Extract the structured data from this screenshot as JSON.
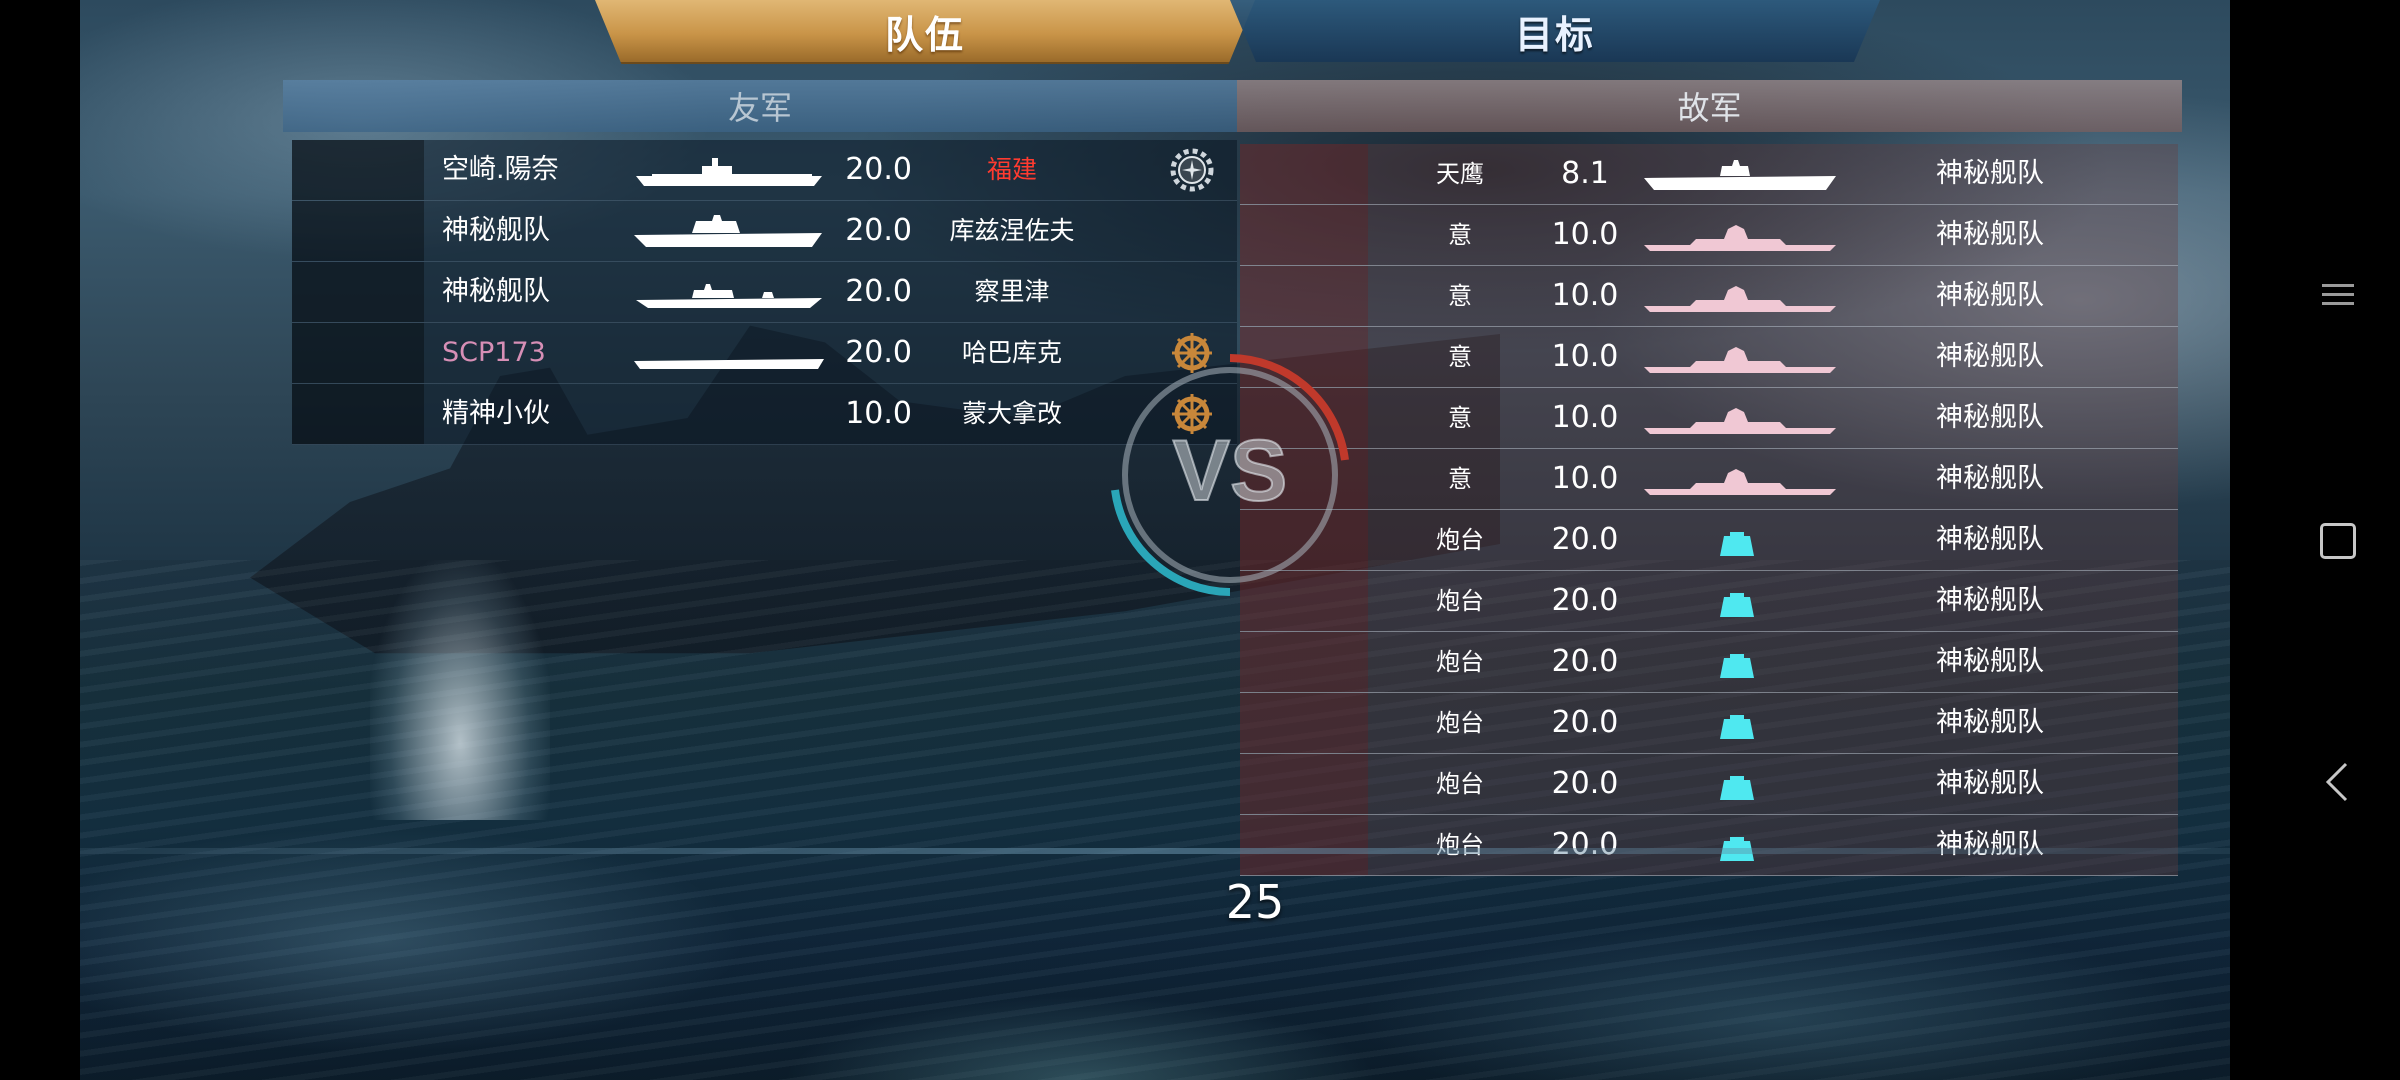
{
  "tabs": {
    "team": "队伍",
    "target": "目标"
  },
  "sections": {
    "friendly": "友军",
    "enemy": "故军"
  },
  "friendly_rows": [
    {
      "player": "空崎.陽奈",
      "level": "20.0",
      "ship": "福建",
      "ship_name_color": "#ff3b30",
      "badge": "gear-icon"
    },
    {
      "player": "神秘舰队",
      "level": "20.0",
      "ship": "库兹涅佐夫",
      "badge": ""
    },
    {
      "player": "神秘舰队",
      "level": "20.0",
      "ship": "察里津",
      "badge": ""
    },
    {
      "player": "SCP173",
      "player_color": "#d78fb6",
      "level": "20.0",
      "ship": "哈巴库克",
      "badge": "ship-wheel-icon"
    },
    {
      "player": "精神小伙",
      "level": "10.0",
      "ship": "蒙大拿改",
      "badge": "ship-wheel-icon"
    }
  ],
  "enemy_rows": [
    {
      "type": "天鹰",
      "level": "8.1",
      "player": "神秘舰队",
      "icon": "carrier-silhouette-icon"
    },
    {
      "type": "意",
      "level": "10.0",
      "player": "神秘舰队",
      "icon": "battleship-silhouette-icon"
    },
    {
      "type": "意",
      "level": "10.0",
      "player": "神秘舰队",
      "icon": "battleship-silhouette-icon"
    },
    {
      "type": "意",
      "level": "10.0",
      "player": "神秘舰队",
      "icon": "battleship-silhouette-icon"
    },
    {
      "type": "意",
      "level": "10.0",
      "player": "神秘舰队",
      "icon": "battleship-silhouette-icon"
    },
    {
      "type": "意",
      "level": "10.0",
      "player": "神秘舰队",
      "icon": "battleship-silhouette-icon"
    },
    {
      "type": "炮台",
      "level": "20.0",
      "player": "神秘舰队",
      "icon": "turret-icon"
    },
    {
      "type": "炮台",
      "level": "20.0",
      "player": "神秘舰队",
      "icon": "turret-icon"
    },
    {
      "type": "炮台",
      "level": "20.0",
      "player": "神秘舰队",
      "icon": "turret-icon"
    },
    {
      "type": "炮台",
      "level": "20.0",
      "player": "神秘舰队",
      "icon": "turret-icon"
    },
    {
      "type": "炮台",
      "level": "20.0",
      "player": "神秘舰队",
      "icon": "turret-icon"
    },
    {
      "type": "炮台",
      "level": "20.0",
      "player": "神秘舰队",
      "icon": "turret-icon"
    }
  ],
  "vs_label": "VS",
  "countdown": "25",
  "colors": {
    "tab_active": "#c99448",
    "friendly_header": "#4f7fa3",
    "enemy_header": "#9b8282",
    "turret_icon": "#4fe8f0",
    "enemy_battleship_icon": "#f0c8d4"
  }
}
